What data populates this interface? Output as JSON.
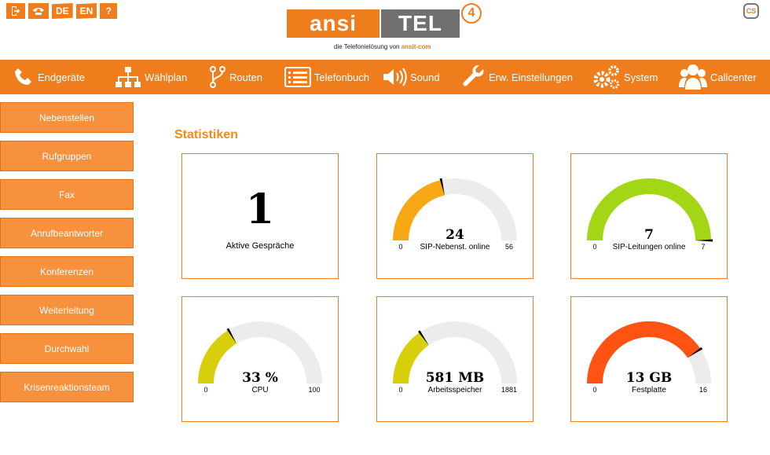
{
  "topbar": {
    "icons": [
      "logout-icon",
      "phone-icon"
    ],
    "languages": [
      "DE",
      "EN"
    ],
    "help_label": "?",
    "cs_label": "CS"
  },
  "logo": {
    "left_text": "ansi",
    "right_text": "TEL",
    "version": "4",
    "tagline_prefix": "die Telefonielösung von",
    "tagline_brand": "ansit-com"
  },
  "nav": [
    {
      "label": "Endgeräte",
      "icon": "phone-icon"
    },
    {
      "label": "Wählplan",
      "icon": "sitemap-icon"
    },
    {
      "label": "Routen",
      "icon": "route-icon"
    },
    {
      "label": "Telefonbuch",
      "icon": "phonebook-icon"
    },
    {
      "label": "Sound",
      "icon": "speaker-icon"
    },
    {
      "label": "Erw. Einstellungen",
      "icon": "wrench-icon"
    },
    {
      "label": "System",
      "icon": "gears-icon"
    },
    {
      "label": "Callcenter",
      "icon": "users-icon"
    }
  ],
  "sidebar": {
    "items": [
      "Nebenstellen",
      "Rufgruppen",
      "Fax",
      "Anrufbeantworter",
      "Konferenzen",
      "Weiterleitung",
      "Durchwahl",
      "Krisenreaktionsteam"
    ]
  },
  "main": {
    "title": "Statistiken",
    "active_calls": {
      "value": "1",
      "label": "Aktive Gespräche"
    }
  },
  "colors": {
    "accent": "#f07d1b",
    "gauge_track": "#ececec",
    "needle": "#000000"
  },
  "chart_data": [
    {
      "type": "gauge",
      "title": "SIP-Nebenst. online",
      "value": 24,
      "display": "24",
      "min": 0,
      "max": 56,
      "color": "#f7a814",
      "min_label": "0",
      "max_label": "56"
    },
    {
      "type": "gauge",
      "title": "SIP-Leitungen online",
      "value": 7,
      "display": "7",
      "min": 0,
      "max": 7,
      "color": "#a3d614",
      "min_label": "0",
      "max_label": "7"
    },
    {
      "type": "gauge",
      "title": "CPU",
      "value": 33,
      "display": "33 %",
      "min": 0,
      "max": 100,
      "color": "#d8cf0c",
      "min_label": "0",
      "max_label": "100"
    },
    {
      "type": "gauge",
      "title": "Arbeitsspeicher",
      "value": 581,
      "display": "581 MB",
      "min": 0,
      "max": 1881,
      "color": "#d8cf0c",
      "min_label": "0",
      "max_label": "1881"
    },
    {
      "type": "gauge",
      "title": "Festplatte",
      "value": 13,
      "display": "13 GB",
      "min": 0,
      "max": 16,
      "color": "#ff5314",
      "min_label": "0",
      "max_label": "16"
    }
  ]
}
